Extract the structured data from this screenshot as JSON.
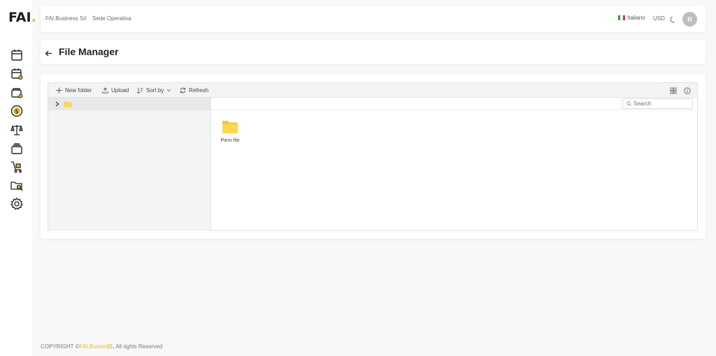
{
  "sidebar": {
    "logo_text": "FAI",
    "logo_dot": ".",
    "icons": [
      "calendar-icon",
      "calendar-user-icon",
      "wallet-icon",
      "dollar-coin-icon",
      "scale-icon",
      "cards-stack-icon",
      "cart-icon",
      "folder-search-icon",
      "gear-icon"
    ]
  },
  "header": {
    "company": "FAI.Business Srl",
    "sede": "Sede Operativa",
    "language": "Italiano",
    "currency": "USD",
    "avatar_initial": "R"
  },
  "page": {
    "title": "File Manager"
  },
  "file_manager": {
    "toolbar": {
      "new_folder": "New folder",
      "upload": "Upload",
      "sort_by": "Sort by",
      "refresh": "Refresh"
    },
    "search_placeholder": "Search",
    "files": [
      {
        "name": "Piero file",
        "type": "folder"
      }
    ]
  },
  "footer": {
    "prefix": "COPYRIGHT ©",
    "brand": "FAI.Busine$$",
    "suffix": ", All rights Reserved"
  },
  "colors": {
    "accent": "#e4b92b",
    "folder": "#f8d24a"
  }
}
